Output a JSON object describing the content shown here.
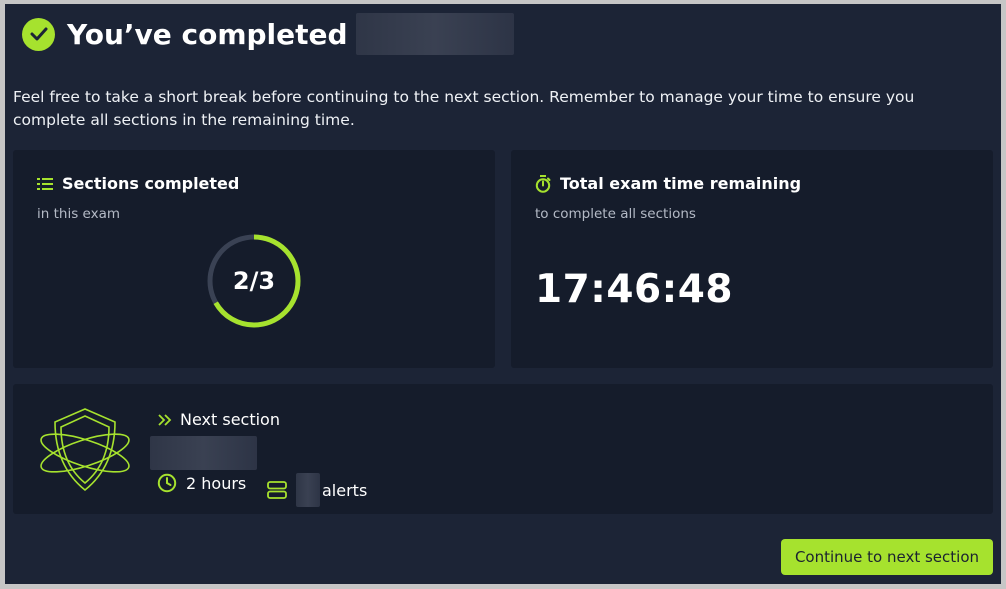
{
  "header": {
    "title": "You’ve completed"
  },
  "intro": "Feel free to take a short break before continuing to the next section. Remember to manage your time to ensure you complete all sections in the remaining time.",
  "sections_card": {
    "title": "Sections completed",
    "subtitle": "in this exam",
    "progress_label": "2/3",
    "completed": 2,
    "total": 3
  },
  "time_card": {
    "title": "Total exam time remaining",
    "subtitle": "to complete all sections",
    "time": "17:46:48"
  },
  "next_card": {
    "label": "Next section",
    "duration": "2 hours",
    "alerts_label": "alerts"
  },
  "footer": {
    "continue_label": "Continue to next section"
  },
  "colors": {
    "accent": "#a6e22e",
    "background": "#1c2436",
    "card": "#151c2b",
    "track": "#3a4254"
  },
  "icons": {
    "header": "check-circle-icon",
    "sections": "list-icon",
    "time": "stopwatch-icon",
    "next": "double-chevron-right-icon",
    "duration": "clock-icon",
    "alerts": "server-stack-icon",
    "illustration": "shield-orbit-icon"
  }
}
